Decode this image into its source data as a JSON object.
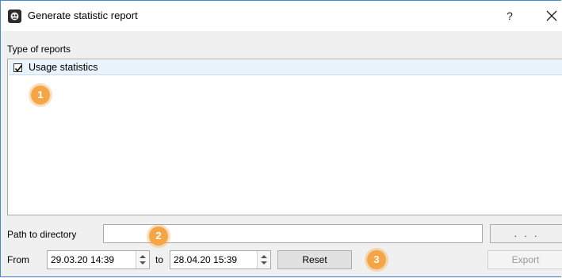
{
  "window": {
    "title": "Generate statistic report",
    "help_label": "?",
    "app_icon": "app-logo-icon",
    "close_icon": "close-icon"
  },
  "reports": {
    "section_label": "Type of reports",
    "items": [
      {
        "label": "Usage statistics",
        "checked": true
      }
    ]
  },
  "path": {
    "label": "Path to directory",
    "value": "",
    "browse_label": ". . ."
  },
  "date_range": {
    "from_label": "From",
    "from_value": "29.03.20 14:39",
    "to_label": "to",
    "to_value": "28.04.20 15:39"
  },
  "buttons": {
    "reset_label": "Reset",
    "export_label": "Export"
  },
  "markers": [
    "1",
    "2",
    "3"
  ],
  "colors": {
    "marker": "#f6a544",
    "window_border": "#3c8fd8",
    "selected_row": "#e9f3fc"
  }
}
